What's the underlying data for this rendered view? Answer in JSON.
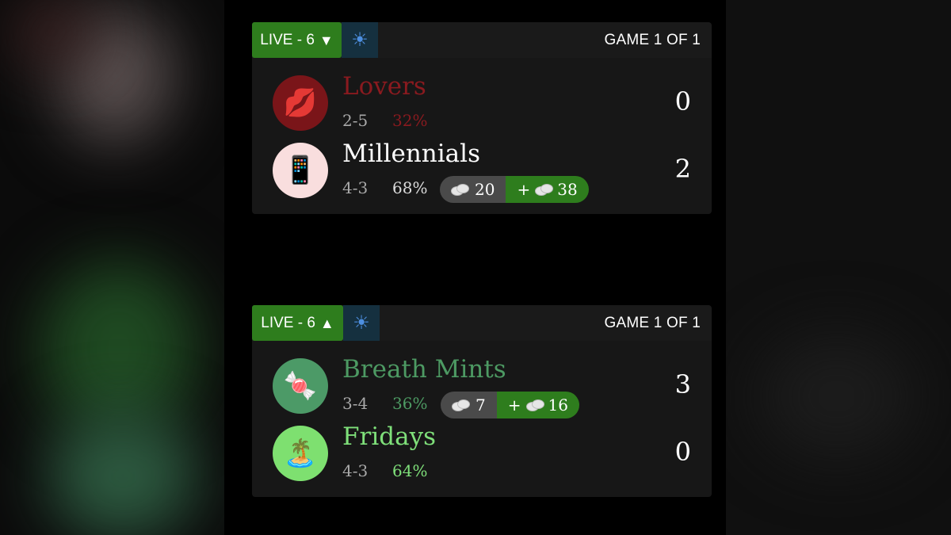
{
  "games": [
    {
      "live_label": "LIVE - 6",
      "arrow": "▼",
      "weather_icon": "sun-icon",
      "game_count": "GAME 1 OF 1",
      "teams": [
        {
          "emoji": "💋",
          "name": "Lovers",
          "record": "2-5",
          "pct": "32%",
          "score": "0",
          "name_color": "#8a1a1f",
          "avatar_bg": "#7a1519"
        },
        {
          "emoji": "📱",
          "name": "Millennials",
          "record": "4-3",
          "pct": "68%",
          "score": "2",
          "name_color": "#ffffff",
          "avatar_bg": "#f9dede",
          "wager": {
            "stake": "20",
            "payout": "38",
            "payout_prefix": "+"
          }
        }
      ]
    },
    {
      "live_label": "LIVE - 6",
      "arrow": "▲",
      "weather_icon": "sun-icon",
      "game_count": "GAME 1 OF 1",
      "teams": [
        {
          "emoji": "🍬",
          "name": "Breath Mints",
          "record": "3-4",
          "pct": "36%",
          "score": "3",
          "name_color": "#4d9a63",
          "avatar_bg": "#4c9a67",
          "wager": {
            "stake": "7",
            "payout": "16",
            "payout_prefix": "+"
          }
        },
        {
          "emoji": "🏝️",
          "name": "Fridays",
          "record": "4-3",
          "pct": "64%",
          "score": "0",
          "name_color": "#7fe07a",
          "avatar_bg": "#7ee070"
        }
      ]
    }
  ]
}
